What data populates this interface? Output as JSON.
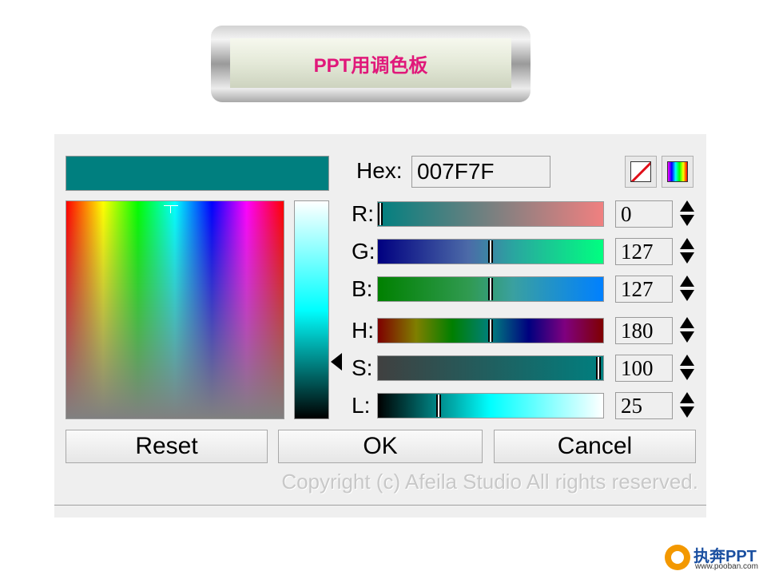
{
  "title": "PPT用调色板",
  "color_picker": {
    "hex_label": "Hex:",
    "hex_value": "007F7F",
    "preview_color": "#007F7F",
    "icons": {
      "no_color": "no-color-icon",
      "spectrum": "spectrum-icon"
    },
    "channels": [
      {
        "key": "r",
        "label": "R:",
        "value": "0",
        "level": 0.01,
        "gradient": "linear-gradient(to right,#008080,#f08080)"
      },
      {
        "key": "g",
        "label": "G:",
        "value": "127",
        "level": 0.5,
        "gradient": "linear-gradient(to right,#000080,#4c6aa8 40%,#2aa5a0 60%,#00ff80)"
      },
      {
        "key": "b",
        "label": "B:",
        "value": "127",
        "level": 0.5,
        "gradient": "linear-gradient(to right,#008000,#309a50 40%,#3aa0a0 60%,#0080ff)"
      },
      {
        "key": "h",
        "label": "H:",
        "value": "180",
        "level": 0.5,
        "gradient": "linear-gradient(to right,#7f0000,#7f7f00 17%,#007f00 33%,#007f7f 50%,#00007f 67%,#7f007f 83%,#7f0000)"
      },
      {
        "key": "s",
        "label": "S:",
        "value": "100",
        "level": 0.98,
        "gradient": "linear-gradient(to right,#404040,#007f7f)"
      },
      {
        "key": "l",
        "label": "L:",
        "value": "25",
        "level": 0.27,
        "gradient": "linear-gradient(to right,#000000,#00ffff 50%,#ffffff)"
      }
    ],
    "buttons": {
      "reset": "Reset",
      "ok": "OK",
      "cancel": "Cancel"
    },
    "copyright": "Copyright (c) Afeila Studio All rights reserved."
  },
  "logo": {
    "text": "执奔PPT",
    "url": "www.pooban.com"
  }
}
